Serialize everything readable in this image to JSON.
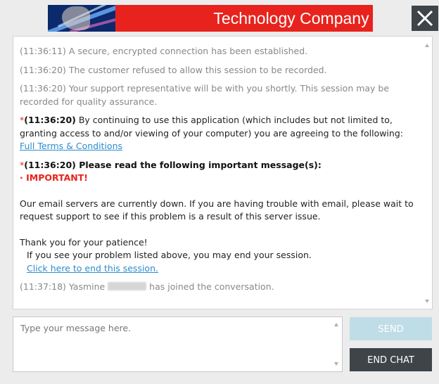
{
  "header": {
    "title": "Technology Company",
    "brand_color": "#e8231d",
    "close_icon": "close-icon"
  },
  "chat": {
    "messages": [
      {
        "text": "(11:36:11) A secure, encrypted connection has been established."
      },
      {
        "text": "(11:36:20) The customer refused to allow this session to be recorded."
      },
      {
        "text": "(11:36:20) Your support representative will be with you shortly. This session may be recorded for quality assurance."
      }
    ],
    "terms": {
      "star": "*",
      "time": "(11:36:20)",
      "text": " By continuing to use this application (which includes but not limited to, granting access to and/or viewing of your computer) you are agreeing to the following: ",
      "link": "Full Terms & Conditions"
    },
    "notice": {
      "star": "*",
      "heading": "(11:36:20) Please read the following important message(s):",
      "bullet": "· IMPORTANT!",
      "body": "Our email servers are currently down. If you are having trouble with email, please wait to request support to see if this problem is a result of this server issue.",
      "thanks": "Thank you for your patience!",
      "end_hint": "If you see your problem listed above, you may end your session.",
      "end_link": "Click here to end this session."
    },
    "join": {
      "prefix": "(11:37:18) Yasmine",
      "suffix": " has joined the conversation."
    }
  },
  "composer": {
    "placeholder": "Type your message here.",
    "send_label": "SEND",
    "end_label": "END CHAT"
  }
}
